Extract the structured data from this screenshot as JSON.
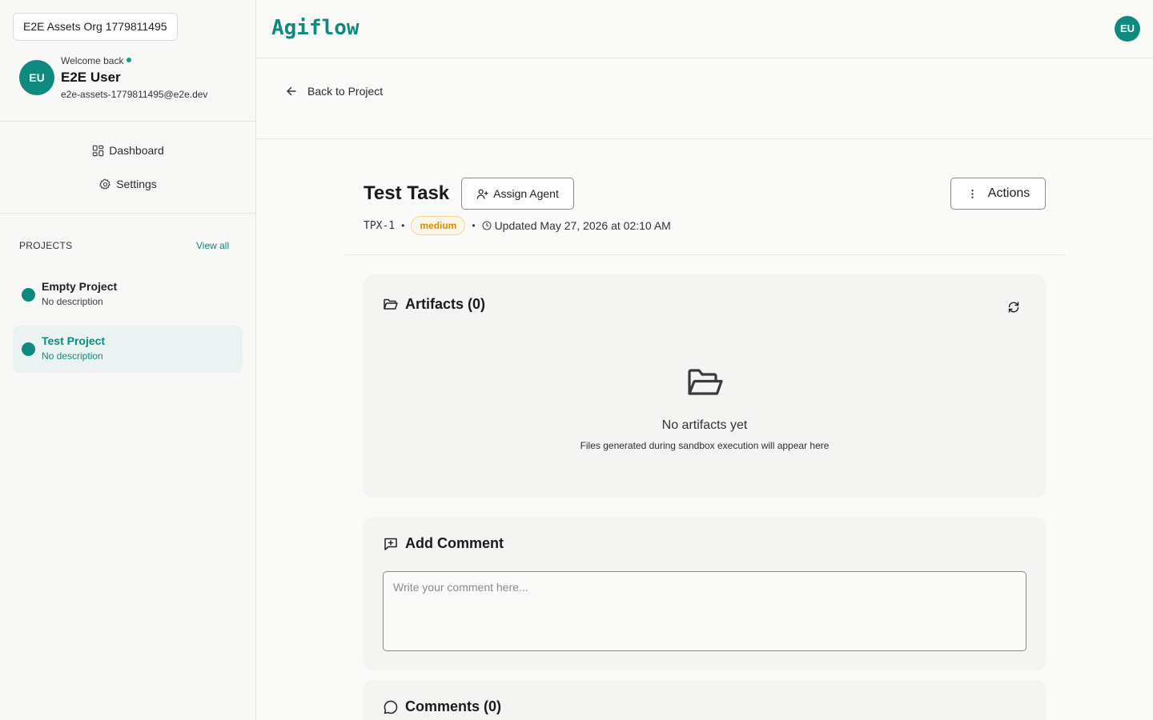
{
  "sidebar": {
    "org_name": "E2E Assets Org 1779811495",
    "user": {
      "initials": "EU",
      "welcome": "Welcome back",
      "name": "E2E User",
      "email": "e2e-assets-1779811495@e2e.dev"
    },
    "nav": [
      {
        "label": "Dashboard",
        "icon": "dashboard-icon"
      },
      {
        "label": "Settings",
        "icon": "gear-icon"
      }
    ],
    "projects_label": "PROJECTS",
    "view_all_label": "View all",
    "projects": [
      {
        "name": "Empty Project",
        "description": "No description",
        "active": false
      },
      {
        "name": "Test Project",
        "description": "No description",
        "active": true
      }
    ]
  },
  "header": {
    "logo_text": "Agiflow",
    "avatar_initials": "EU"
  },
  "back_link_label": "Back to Project",
  "task": {
    "title": "Test Task",
    "assign_agent_label": "Assign Agent",
    "actions_label": "Actions",
    "key": "TPX-1",
    "priority": "medium",
    "updated": "Updated May 27, 2026 at 02:10 AM"
  },
  "artifacts": {
    "title": "Artifacts (0)",
    "empty_title": "No artifacts yet",
    "empty_subtitle": "Files generated during sandbox execution will appear here"
  },
  "add_comment": {
    "title": "Add Comment",
    "placeholder": "Write your comment here...",
    "value": ""
  },
  "comments": {
    "title": "Comments (0)"
  },
  "colors": {
    "accent": "#0f8a7e",
    "priority_medium_text": "#d98b06",
    "priority_medium_bg": "#fdf6e6"
  }
}
